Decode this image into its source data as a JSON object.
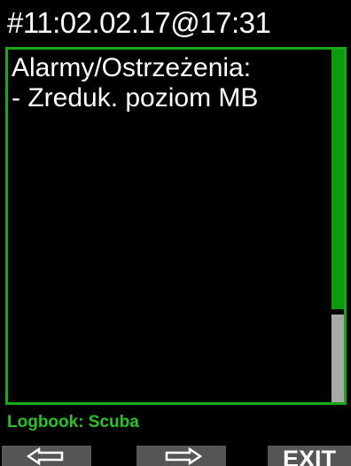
{
  "header": {
    "title": "#11:02.02.17@17:31"
  },
  "message": {
    "lines": [
      "Alarmy/Ostrzeżenia:",
      "- Zreduk. poziom MB"
    ]
  },
  "footer": {
    "label": "Logbook: Scuba"
  },
  "softkeys": {
    "left_icon": "arrow-left-icon",
    "right_icon": "arrow-right-icon",
    "exit_label": "EXIT"
  },
  "colors": {
    "accent": "#18a818",
    "footer_text": "#29c229",
    "button_bg": "#555555",
    "scroll_thumb": "#a8a8a8"
  }
}
